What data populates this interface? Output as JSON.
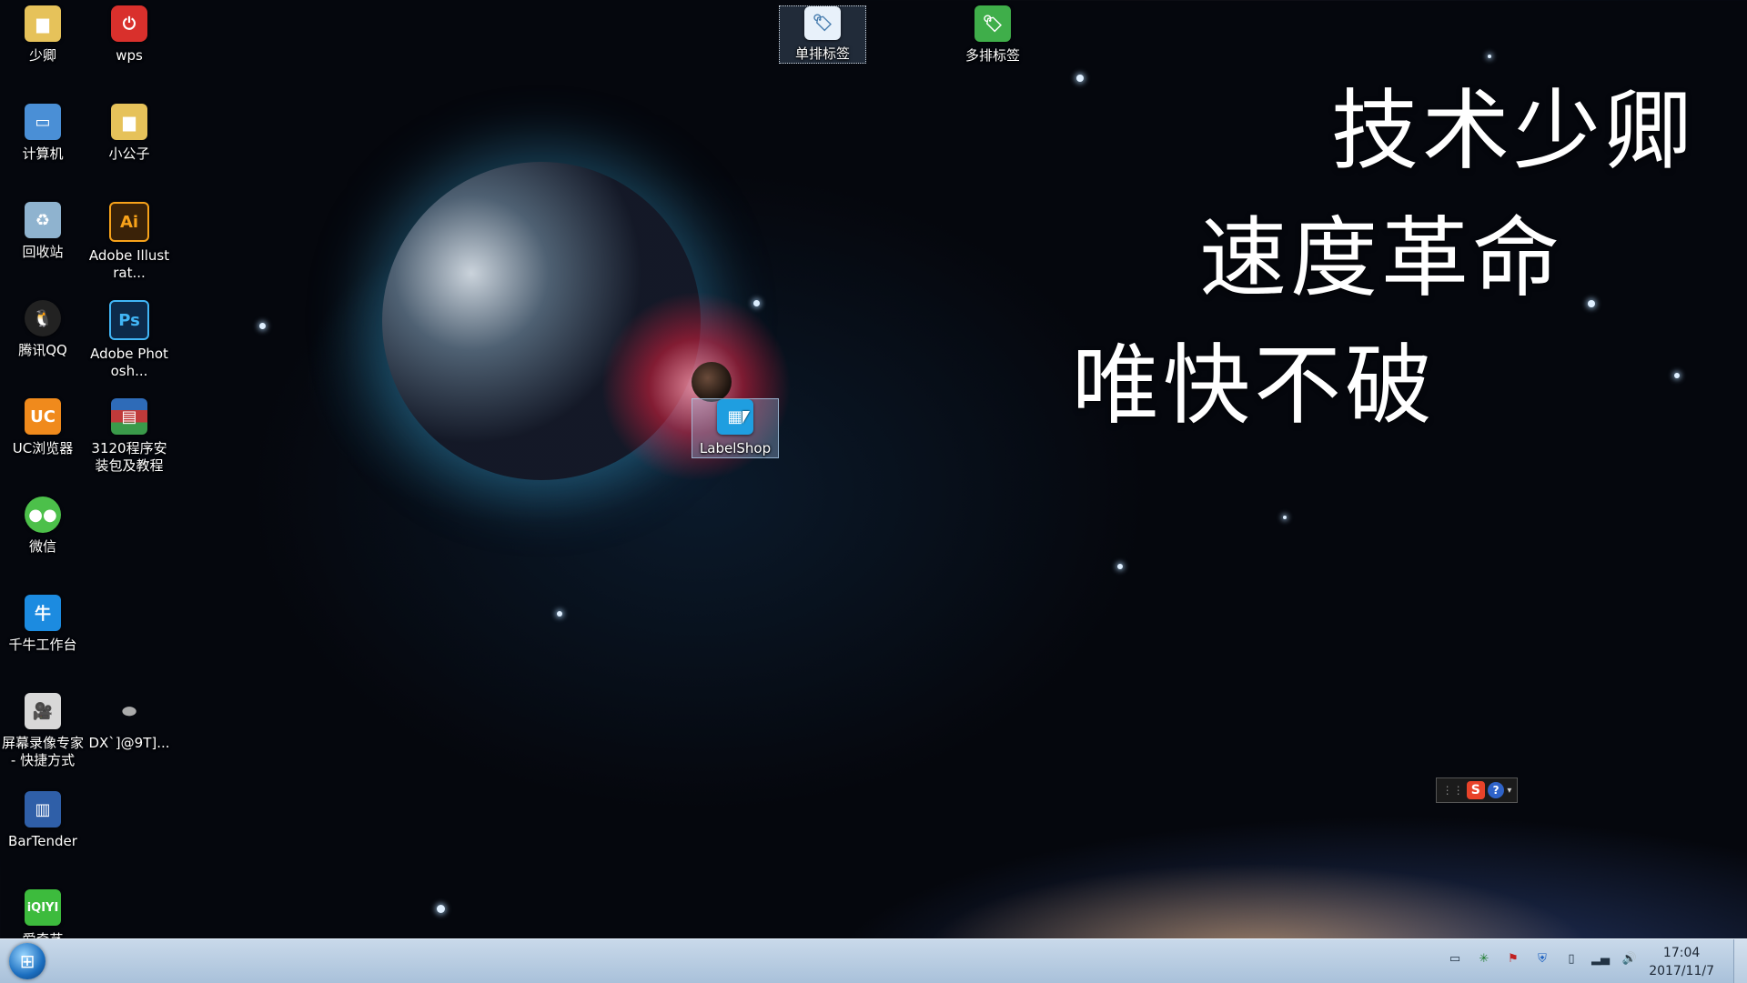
{
  "desktop": {
    "icons_left": [
      {
        "label": "少卿",
        "icon": "folder-icon",
        "color": "#e6c25a"
      },
      {
        "label": "wps",
        "icon": "wps-icon",
        "color": "#d9302c"
      },
      {
        "label": "计算机",
        "icon": "computer-icon",
        "color": "#4a8fd6"
      },
      {
        "label": "小公子",
        "icon": "folder-icon",
        "color": "#e6c25a"
      },
      {
        "label": "回收站",
        "icon": "recycle-bin-icon",
        "color": "#8fb3cf"
      },
      {
        "label": "Adobe Illustrat...",
        "icon": "illustrator-icon",
        "color": "#3a2208"
      },
      {
        "label": "腾讯QQ",
        "icon": "qq-icon",
        "color": "#222222"
      },
      {
        "label": "Adobe Photosh...",
        "icon": "photoshop-icon",
        "color": "#0d2a4a"
      },
      {
        "label": "UC浏览器",
        "icon": "uc-browser-icon",
        "color": "#f08a1c"
      },
      {
        "label": "3120程序安装包及教程",
        "icon": "archive-icon",
        "color": "#2e6bb8"
      },
      {
        "label": "微信",
        "icon": "wechat-icon",
        "color": "#4cc04a"
      },
      {
        "label": "千牛工作台",
        "icon": "qianniu-icon",
        "color": "#1c8be0"
      },
      {
        "label": "屏幕录像专家 - 快捷方式",
        "icon": "screen-recorder-icon",
        "color": "#d8d8d8"
      },
      {
        "label": "DX`]@9T]...",
        "icon": "image-file-icon",
        "color": "#555555"
      },
      {
        "label": "BarTender",
        "icon": "bartender-icon",
        "color": "#2f5fa8"
      },
      {
        "label": "爱奇艺",
        "icon": "iqiyi-icon",
        "color": "#3dbb3d"
      }
    ],
    "icons_top": [
      {
        "label": "单排标签",
        "icon": "label-file-icon",
        "color": "#9fc7e8"
      },
      {
        "label": "多排标签",
        "icon": "label-file-icon-green",
        "color": "#3fae4a"
      }
    ],
    "dragged_icon": {
      "label": "LabelShop",
      "icon": "labelshop-icon",
      "color": "#1f9ee0"
    },
    "slogan": {
      "line1": "技术少卿",
      "line2": "速度革命",
      "line3": "唯快不破"
    },
    "ime_toolbar": {
      "logo": "S",
      "help": "?"
    }
  },
  "taskbar": {
    "clock_time": "17:04",
    "clock_date": "2017/11/7",
    "tray_icons": [
      "monitor-icon",
      "network-app-icon",
      "flag-x-icon",
      "shield-icon",
      "battery-icon",
      "signal-icon",
      "volume-icon"
    ]
  }
}
